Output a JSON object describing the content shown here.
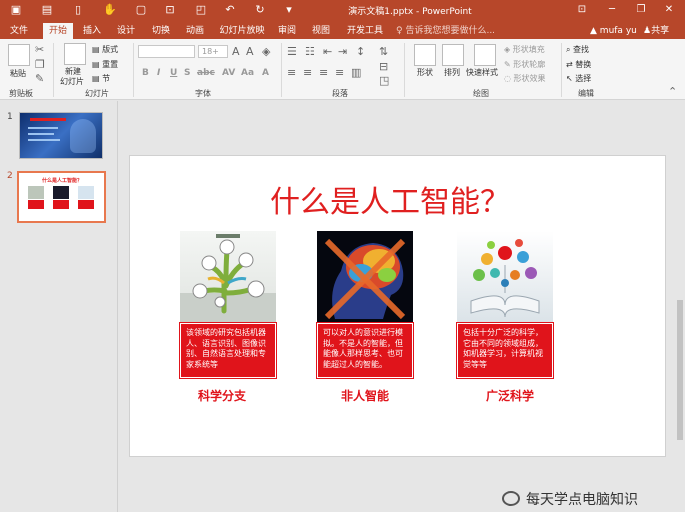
{
  "window": {
    "title": "演示文稿1.pptx - PowerPoint",
    "user": "mufa yu",
    "share_label": "共享"
  },
  "tabs": [
    {
      "label": "文件",
      "active": false
    },
    {
      "label": "开始",
      "active": true
    },
    {
      "label": "插入",
      "active": false
    },
    {
      "label": "设计",
      "active": false
    },
    {
      "label": "切换",
      "active": false
    },
    {
      "label": "动画",
      "active": false
    },
    {
      "label": "幻灯片放映",
      "active": false
    },
    {
      "label": "审阅",
      "active": false
    },
    {
      "label": "视图",
      "active": false
    },
    {
      "label": "开发工具",
      "active": false
    }
  ],
  "tell_me_placeholder": "告诉我您想要做什么...",
  "ribbon": {
    "clipboard": {
      "group": "剪贴板",
      "paste": "粘贴"
    },
    "slides": {
      "group": "幻灯片",
      "new_slide_1": "新建",
      "new_slide_2": "幻灯片",
      "layout": "版式",
      "reset": "重置",
      "section": "节"
    },
    "font": {
      "group": "字体",
      "size": "18+"
    },
    "paragraph": {
      "group": "段落"
    },
    "drawing": {
      "group": "绘图",
      "shapes": "形状",
      "arrange": "排列",
      "quick_styles": "快速样式",
      "shape_fill": "形状填充",
      "shape_outline": "形状轮廓",
      "shape_effects": "形状效果"
    },
    "editing": {
      "group": "编辑",
      "find": "查找",
      "replace": "替换",
      "select": "选择"
    }
  },
  "thumbnails": [
    {
      "number": "1",
      "selected": false
    },
    {
      "number": "2",
      "selected": true,
      "title": "什么是人工智能？"
    }
  ],
  "slide": {
    "title": "什么是人工智能？",
    "cards": [
      {
        "text": "该领域的研究包括机器人、语言识别、图像识别、自然语言处理和专家系统等",
        "caption": "科学分支"
      },
      {
        "text": "可以对人的意识进行模拟。不是人的智能，但能像人那样思考、也可能超过人的智能。",
        "caption": "非人智能"
      },
      {
        "text": "包括十分广泛的科学，它由不同的领域组成，如机器学习，计算机视觉等等",
        "caption": "广泛科学"
      }
    ]
  },
  "watermark": "每天学点电脑知识",
  "colors": {
    "accent": "#b7472a",
    "slide_red": "#e0141b"
  }
}
